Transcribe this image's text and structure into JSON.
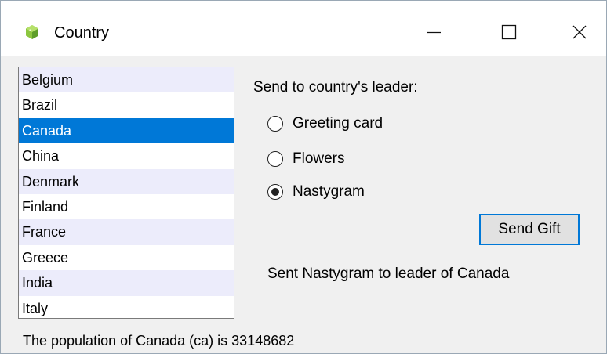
{
  "window": {
    "title": "Country",
    "app_icon": "gem-icon",
    "controls": {
      "minimize": "minimize-icon",
      "maximize": "maximize-icon",
      "close": "close-icon"
    }
  },
  "countries": {
    "items": [
      {
        "label": "Belgium"
      },
      {
        "label": "Brazil"
      },
      {
        "label": "Canada"
      },
      {
        "label": "China"
      },
      {
        "label": "Denmark"
      },
      {
        "label": "Finland"
      },
      {
        "label": "France"
      },
      {
        "label": "Greece"
      },
      {
        "label": "India"
      },
      {
        "label": "Italy"
      }
    ],
    "selected": "Canada"
  },
  "gift": {
    "prompt": "Send to country's leader:",
    "options": [
      {
        "label": "Greeting card",
        "checked": false
      },
      {
        "label": "Flowers",
        "checked": false
      },
      {
        "label": "Nastygram",
        "checked": true
      }
    ],
    "send_label": "Send Gift",
    "result": "Sent Nastygram to leader of Canada"
  },
  "status": {
    "text": "The population of Canada (ca) is 33148682"
  },
  "colors": {
    "selection": "#0078d7",
    "alt_row": "#ececfb",
    "button_border": "#0078d7"
  }
}
